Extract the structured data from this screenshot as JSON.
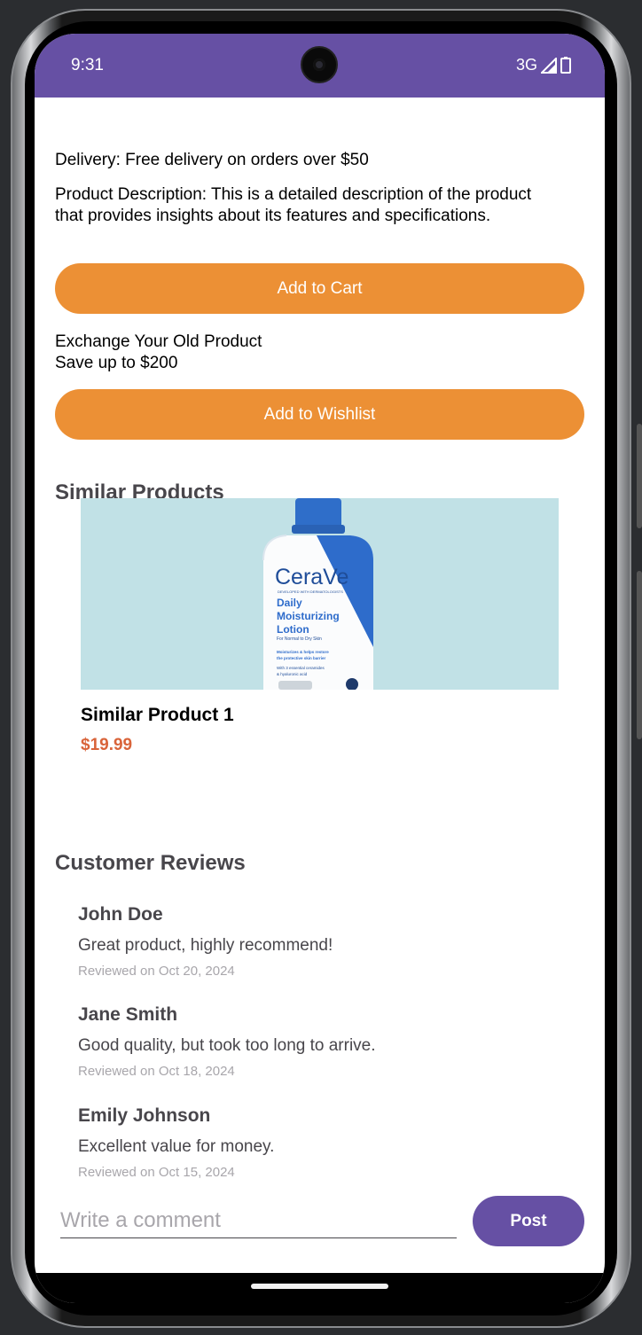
{
  "status_bar": {
    "time": "9:31",
    "network": "3G",
    "background_color": "#6650a4"
  },
  "product": {
    "delivery": "Delivery: Free delivery on orders over $50",
    "description_line1": "Product Description: This is a detailed description of the product",
    "description_line2": "that provides insights about its features and specifications.",
    "add_to_cart_label": "Add to Cart",
    "exchange_line1": "Exchange Your Old Product",
    "exchange_line2": "Save up to $200",
    "add_to_wishlist_label": "Add to Wishlist",
    "button_color": "#ec9035"
  },
  "similar_products": {
    "title": "Similar Products",
    "items": [
      {
        "name": "Similar Product 1",
        "price": "$19.99",
        "image": {
          "brand": "CeraVe",
          "tagline": "DEVELOPED WITH DERMATOLOGISTS",
          "product_line1": "Daily",
          "product_line2": "Moisturizing",
          "product_line3": "Lotion",
          "skin_type": "For Normal to Dry Skin",
          "benefit_line1": "Moisturizes & helps restore",
          "benefit_line2": "the protective skin barrier",
          "ingredients_line1": "With 3 essential ceramides",
          "ingredients_line2": "& hyaluronic acid"
        }
      }
    ]
  },
  "reviews": {
    "title": "Customer Reviews",
    "items": [
      {
        "name": "John Doe",
        "text": "Great product, highly recommend!",
        "date": "Reviewed on Oct 20, 2024"
      },
      {
        "name": "Jane Smith",
        "text": "Good quality, but took too long to arrive.",
        "date": "Reviewed on Oct 18, 2024"
      },
      {
        "name": "Emily Johnson",
        "text": "Excellent value for money.",
        "date": "Reviewed on Oct 15, 2024"
      }
    ]
  },
  "comment": {
    "placeholder": "Write a comment",
    "value": "",
    "post_label": "Post"
  }
}
